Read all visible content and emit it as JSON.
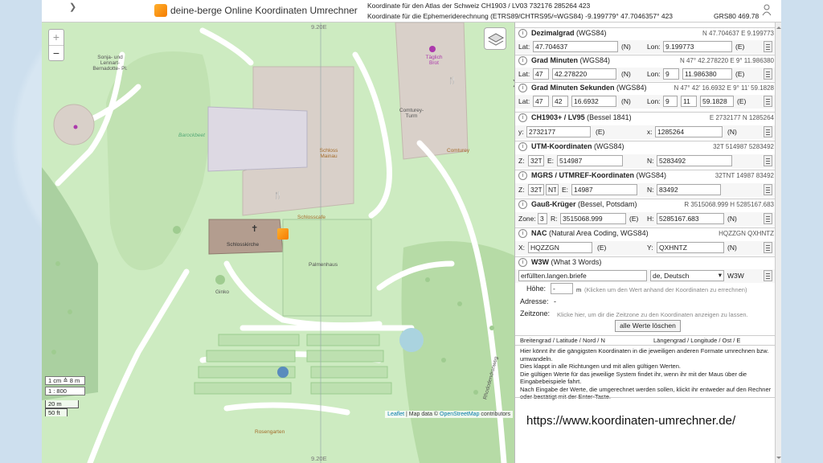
{
  "header": {
    "app_title": "deine-berge Online Koordinaten Umrechner",
    "line1": "Koordinate für den Atlas der Schweiz CH1903 / LV03 732176 285264 423",
    "line2": "Koordinate für die Ephemeriderechnung  (ETRS89/CHTRS95/≈WGS84) -9.199779° 47.7046357° 423",
    "grs": "GRS80  469.78"
  },
  "map": {
    "zoom_in": "+",
    "zoom_out": "−",
    "labels": {
      "coord_top": "9.20E",
      "coord_bottom": "9.20E",
      "sonja": "Sonja- und Lennart- Bernadotte- Pl.",
      "barockbeet": "Barockbeet",
      "schloss_mainau": "Schloss Mainau",
      "schlosskirche": "Schlosskirche",
      "schlosscafe": "Schlosscafe",
      "palmenhaus": "Palmenhaus",
      "ginko": "Ginko",
      "rosengarten": "Rosengarten",
      "comturey_turm": "Comturey- Turm",
      "comturey": "Comturey",
      "taeglich_brot": "Täglich Brot",
      "road": "Rhododendronweg"
    },
    "scale": {
      "zoom_text": "1 cm  ≙ 8 m",
      "ratio": "1 : 800",
      "meters": "20 m",
      "feet": "50 ft"
    },
    "attribution": {
      "leaflet": "Leaflet",
      "sep": " | Map data © ",
      "osm": "OpenStreetMap",
      "contrib": " contributors"
    }
  },
  "panel": {
    "dezimal": {
      "name": "Dezimalgrad",
      "datum": "(WGS84)",
      "value": "N 47.704637 E 9.199773",
      "lat_label": "Lat:",
      "lat": "47.704637",
      "lat_unit": "(N)",
      "lon_label": "Lon:",
      "lon": "9.199773",
      "lon_unit": "(E)"
    },
    "gradmin": {
      "name": "Grad Minuten",
      "datum": "(WGS84)",
      "value": "N 47° 42.278220 E 9° 11.986380",
      "lat_label": "Lat:",
      "lat_d": "47",
      "lat_m": "42.278220",
      "lat_unit": "(N)",
      "lon_label": "Lon:",
      "lon_d": "9",
      "lon_m": "11.986380",
      "lon_unit": "(E)"
    },
    "gradminsek": {
      "name": "Grad Minuten Sekunden",
      "datum": "(WGS84)",
      "value": "N 47° 42' 16.6932 E 9° 11' 59.1828",
      "lat_label": "Lat:",
      "lat_d": "47",
      "lat_m": "42",
      "lat_s": "16.6932",
      "lat_unit": "(N)",
      "lon_label": "Lon:",
      "lon_d": "9",
      "lon_m": "11",
      "lon_s": "59.1828",
      "lon_unit": "(E)"
    },
    "ch1903": {
      "name": "CH1903+ / LV95",
      "datum": "(Bessel 1841)",
      "value": "E 2732177 N 1285264",
      "y_label": "y:",
      "y": "2732177",
      "y_unit": "(E)",
      "x_label": "x:",
      "x": "1285264",
      "x_unit": "(N)"
    },
    "utm": {
      "name": "UTM-Koordinaten",
      "datum": "(WGS84)",
      "value": "32T 514987 5283492",
      "z_label": "Z:",
      "z": "32T",
      "e_label": "E:",
      "e": "514987",
      "n_label": "N:",
      "n": "5283492"
    },
    "mgrs": {
      "name": "MGRS / UTMREF-Koordinaten",
      "datum": "(WGS84)",
      "value": "32TNT 14987 83492",
      "z_label": "Z:",
      "z": "32T",
      "sq": "NT",
      "e_label": "E:",
      "e": "14987",
      "n_label": "N:",
      "n": "83492"
    },
    "gauss": {
      "name": "Gauß-Krüger",
      "datum": "(Bessel, Potsdam)",
      "value": "R 3515068.999 H 5285167.683",
      "zone_label": "Zone:",
      "zone": "3",
      "r_label": "R:",
      "r": "3515068.999",
      "r_unit": "(E)",
      "h_label": "H:",
      "h": "5285167.683",
      "h_unit": "(N)"
    },
    "nac": {
      "name": "NAC",
      "datum": "(Natural Area Coding, WGS84)",
      "value": "HQZZGN QXHNTZ",
      "x_label": "X:",
      "x": "HQZZGN",
      "x_unit": "(E)",
      "y_label": "Y:",
      "y": "QXHNTZ",
      "y_unit": "(N)"
    },
    "w3w": {
      "name": "W3W",
      "datum": "(What 3 Words)",
      "words": "erfüllten.langen.briefe",
      "lang": "de, Deutsch",
      "tag": "W3W"
    },
    "hoehe_label": "Höhe:",
    "hoehe_value": "-",
    "hoehe_unit": "m",
    "hoehe_hint": "(Klicken um den Wert anhand der Koordinaten zu errechnen)",
    "adresse_label": "Adresse:",
    "adresse_value": "-",
    "zeitzone_label": "Zeitzone:",
    "zeitzone_hint": "Klicke hier, um dir die Zeitzone zu den Koordinaten anzeigen zu lassen.",
    "clear_btn": "alle Werte löschen",
    "bl_left": "Breitengrad / Latitude / Nord / N",
    "bl_right": "Längengrad / Longitude / Ost / E",
    "help1": "Hier könnt ihr die gängigsten Koordinaten in die jeweiligen anderen Formate umrechnen bzw. umwandeln.",
    "help2": "Dies klappt in alle Richtungen und mit allen gültigen Werten.",
    "help3": "Die gültigen Werte für das jeweilige System findet ihr, wenn ihr mit der Maus über die Eingabebeispiele fahrt.",
    "help4": "Nach Eingabe der Werte, die umgerechnet werden sollen, klickt ihr entweder auf den Rechner oder bestätigt mit der Enter-Taste.",
    "url": "https://www.koordinaten-umrechner.de/"
  },
  "colors": {
    "map_green": "#cdebc1",
    "building": "#d9d0c9",
    "path": "#ffffff",
    "accent_orange": "#f57c00"
  }
}
